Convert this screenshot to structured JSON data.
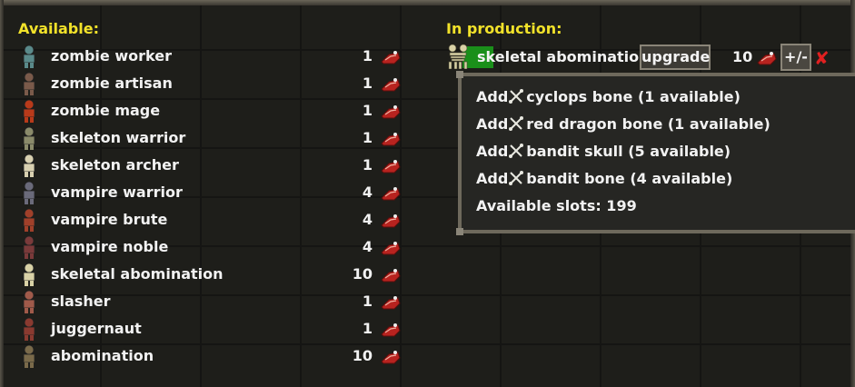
{
  "available": {
    "heading": "Available:",
    "units": [
      {
        "name": "zombie worker",
        "cost": "1",
        "icon": "zombie-worker-icon"
      },
      {
        "name": "zombie artisan",
        "cost": "1",
        "icon": "zombie-artisan-icon"
      },
      {
        "name": "zombie mage",
        "cost": "1",
        "icon": "zombie-mage-icon"
      },
      {
        "name": "skeleton warrior",
        "cost": "1",
        "icon": "skeleton-warrior-icon"
      },
      {
        "name": "skeleton archer",
        "cost": "1",
        "icon": "skeleton-archer-icon"
      },
      {
        "name": "vampire warrior",
        "cost": "4",
        "icon": "vampire-warrior-icon"
      },
      {
        "name": "vampire brute",
        "cost": "4",
        "icon": "vampire-brute-icon"
      },
      {
        "name": "vampire noble",
        "cost": "4",
        "icon": "vampire-noble-icon"
      },
      {
        "name": "skeletal abomination",
        "cost": "10",
        "icon": "skeletal-abomination-icon"
      },
      {
        "name": "slasher",
        "cost": "1",
        "icon": "slasher-icon"
      },
      {
        "name": "juggernaut",
        "cost": "1",
        "icon": "juggernaut-icon"
      },
      {
        "name": "abomination",
        "cost": "10",
        "icon": "abomination-icon"
      }
    ]
  },
  "production": {
    "heading": "In production:",
    "item": {
      "name": "skeletal abomination",
      "upgrade_label": "upgrade",
      "count": "10",
      "adjust_label": "+/-",
      "remove_glyph": "✘"
    }
  },
  "upgrade_popup": {
    "lines": [
      {
        "prefix": "Add",
        "text": "cyclops bone (1 available)"
      },
      {
        "prefix": "Add",
        "text": "red dragon bone (1 available)"
      },
      {
        "prefix": "Add",
        "text": "bandit skull (5 available)"
      },
      {
        "prefix": "Add",
        "text": "bandit bone (4 available)"
      }
    ],
    "slots": "Available slots: 199"
  },
  "colors": {
    "heading": "#f2e22a",
    "text": "#f2f2f2",
    "production_highlight": "#1a8f1a",
    "remove": "#e12020",
    "meat": "#b8231f"
  }
}
